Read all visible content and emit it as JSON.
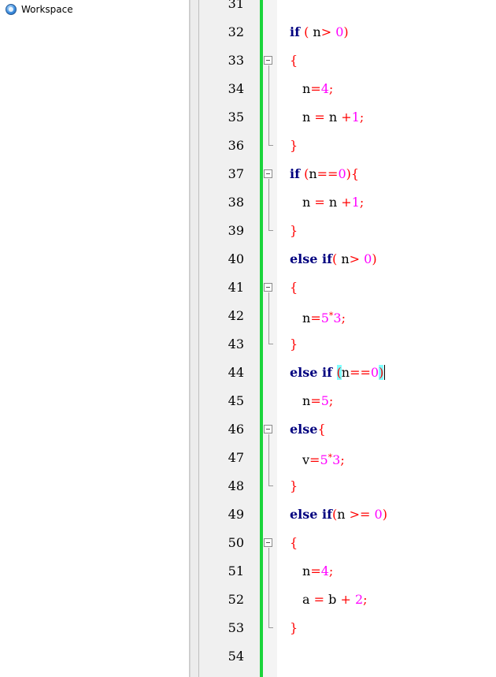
{
  "workspace": {
    "label": "Workspace",
    "icon": "workspace-globe-icon"
  },
  "editor": {
    "line_numbers": [
      "31",
      "32",
      "33",
      "34",
      "35",
      "36",
      "37",
      "38",
      "39",
      "40",
      "41",
      "42",
      "43",
      "44",
      "45",
      "46",
      "47",
      "48",
      "49",
      "50",
      "51",
      "52",
      "53",
      "54"
    ],
    "lines": {
      "l32": {
        "kw": "if",
        "t1": " ",
        "p1": "(",
        "t2": " n",
        "op": ">",
        "t3": " ",
        "num": "0",
        "p2": ")"
      },
      "l33": {
        "b": "{"
      },
      "l34": {
        "id": "n",
        "op": "=",
        "num": "4",
        "semi": ";"
      },
      "l35": {
        "id": "n ",
        "op1": "=",
        "id2": " n ",
        "op2": "+",
        "num": "1",
        "semi": ";"
      },
      "l36": {
        "b": "}"
      },
      "l37": {
        "kw": "if",
        "t1": " ",
        "p1": "(",
        "id": "n",
        "op": "==",
        "num": "0",
        "p2": ")",
        "b": "{"
      },
      "l38": {
        "id": "n ",
        "op1": "=",
        "id2": " n ",
        "op2": "+",
        "num": "1",
        "semi": ";"
      },
      "l39": {
        "b": "}"
      },
      "l40": {
        "kw": "else if",
        "p1": "(",
        "t2": " n",
        "op": ">",
        "t3": " ",
        "num": "0",
        "p2": ")"
      },
      "l41": {
        "b": "{"
      },
      "l42": {
        "id": "n",
        "op": "=",
        "num1": "5",
        "star": "*",
        "num2": "3",
        "semi": ";"
      },
      "l43": {
        "b": "}"
      },
      "l44": {
        "kw": "else if ",
        "p1": "(",
        "id": "n",
        "op": "==",
        "num": "0",
        "p2": ")"
      },
      "l45": {
        "id": "n",
        "op": "=",
        "num": "5",
        "semi": ";"
      },
      "l46": {
        "kw": "else",
        "b": "{"
      },
      "l47": {
        "id": "v",
        "op": "=",
        "num1": "5",
        "star": "*",
        "num2": "3",
        "semi": ";"
      },
      "l48": {
        "b": "}"
      },
      "l49": {
        "kw": "else if",
        "p1": "(",
        "id": "n ",
        "op": ">=",
        "t3": " ",
        "num": "0",
        "p2": ")"
      },
      "l50": {
        "b": "{"
      },
      "l51": {
        "id": "n",
        "op": "=",
        "num": "4",
        "semi": ";"
      },
      "l52": {
        "id": "a ",
        "op1": "=",
        "id2": " b ",
        "op2": "+",
        "t3": " ",
        "num": "2",
        "semi": ";"
      },
      "l53": {
        "b": "}"
      }
    },
    "colors": {
      "keyword": "#00007f",
      "operator": "#ff0000",
      "number": "#ff00ff",
      "change_bar": "#1bd43b",
      "brace_highlight": "#7fffff"
    }
  }
}
